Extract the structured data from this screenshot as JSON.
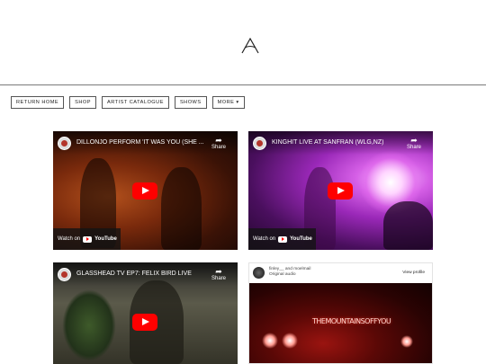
{
  "header": {
    "logo_icon": "a-triangle-logo"
  },
  "nav": {
    "items": [
      "RETURN HOME",
      "SHOP",
      "ARTIST CATALOGUE",
      "SHOWS",
      "MORE ▾"
    ]
  },
  "videos": [
    {
      "title": "DILLONJO PERFORM 'IT WAS YOU (SHE ...",
      "share": "Share",
      "watch_on": "Watch on",
      "platform": "YouTube"
    },
    {
      "title": "KINGHIT LIVE AT SANFRAN (WLG,NZ)",
      "share": "Share",
      "watch_on": "Watch on",
      "platform": "YouTube"
    },
    {
      "title": "GLASSHEAD TV EP7: FELIX BIRD LIVE",
      "share": "Share"
    }
  ],
  "instagram": {
    "user": "finley__ and moelmail",
    "audio": "Original audio",
    "view_profile": "View profile",
    "sign_text": "THEMOUNTAINSOFFYOU"
  },
  "colors": {
    "youtube_red": "#ff0000",
    "border": "#555555"
  }
}
